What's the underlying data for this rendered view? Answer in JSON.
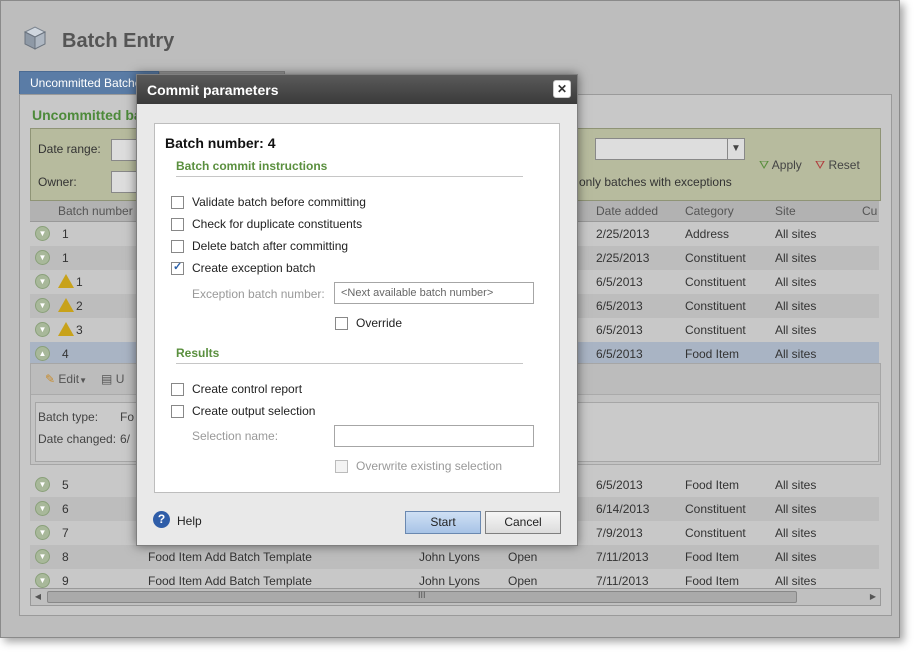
{
  "app": {
    "title": "Batch Entry"
  },
  "tabs": [
    {
      "label": "Uncommitted Batches"
    },
    {
      "label": ""
    }
  ],
  "section_title": "Uncommitted batches",
  "filters": {
    "date_range_label": "Date range:",
    "owner_label": "Owner:",
    "apply_label": "Apply",
    "reset_label": "Reset",
    "only_exceptions_label": "only batches with exceptions"
  },
  "grid": {
    "headers": [
      "Batch number",
      "Date added",
      "Category",
      "Site",
      "Cu"
    ],
    "rows_top": [
      {
        "batch": "1",
        "warn": false,
        "date": "2/25/2013",
        "category": "Address",
        "site": "All sites"
      },
      {
        "batch": "1",
        "warn": false,
        "date": "2/25/2013",
        "category": "Constituent",
        "site": "All sites"
      },
      {
        "batch": "1",
        "warn": true,
        "date": "6/5/2013",
        "category": "Constituent",
        "site": "All sites"
      },
      {
        "batch": "2",
        "warn": true,
        "date": "6/5/2013",
        "category": "Constituent",
        "site": "All sites"
      },
      {
        "batch": "3",
        "warn": true,
        "date": "6/5/2013",
        "category": "Constituent",
        "site": "All sites"
      },
      {
        "batch": "4",
        "warn": false,
        "date": "6/5/2013",
        "category": "Food Item",
        "site": "All sites"
      }
    ],
    "rows_bottom": [
      {
        "batch": "5",
        "template": "",
        "owner": "",
        "status": "",
        "date": "6/5/2013",
        "category": "Food Item",
        "site": "All sites"
      },
      {
        "batch": "6",
        "template": "",
        "owner": "",
        "status": "",
        "date": "6/14/2013",
        "category": "Constituent",
        "site": "All sites"
      },
      {
        "batch": "7",
        "template": "",
        "owner": "",
        "status": "",
        "date": "7/9/2013",
        "category": "Constituent",
        "site": "All sites"
      },
      {
        "batch": "8",
        "template": "Food Item Add Batch Template",
        "owner": "John Lyons",
        "status": "Open",
        "date": "7/11/2013",
        "category": "Food Item",
        "site": "All sites"
      },
      {
        "batch": "9",
        "template": "Food Item Add Batch Template",
        "owner": "John Lyons",
        "status": "Open",
        "date": "7/11/2013",
        "category": "Food Item",
        "site": "All sites"
      }
    ],
    "expanded": {
      "edit_label": "Edit",
      "update_label": "U",
      "batch_type_label": "Batch type:",
      "batch_type_value": "Fo",
      "date_changed_label": "Date changed:",
      "date_changed_value": "6/"
    },
    "scroll_thumb_text": "III"
  },
  "modal": {
    "title": "Commit parameters",
    "batch_number_label": "Batch number:",
    "batch_number_value": "4",
    "instructions_heading": "Batch commit instructions",
    "options": [
      {
        "label": "Validate batch before committing",
        "checked": false
      },
      {
        "label": "Check for duplicate constituents",
        "checked": false
      },
      {
        "label": "Delete batch after committing",
        "checked": false
      },
      {
        "label": "Create exception batch",
        "checked": true
      }
    ],
    "exception_batch_label": "Exception batch number:",
    "exception_batch_placeholder": "<Next available batch number>",
    "override_label": "Override",
    "results_heading": "Results",
    "results_options": [
      {
        "label": "Create control report",
        "checked": false
      },
      {
        "label": "Create output selection",
        "checked": false
      }
    ],
    "selection_name_label": "Selection name:",
    "selection_name_value": "",
    "overwrite_label": "Overwrite existing selection",
    "help_label": "Help",
    "start_label": "Start",
    "cancel_label": "Cancel"
  }
}
